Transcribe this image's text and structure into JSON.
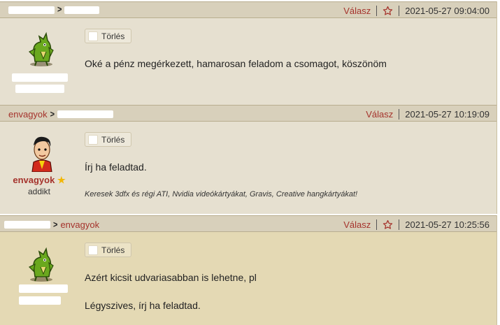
{
  "common": {
    "reply_label": "Válasz",
    "delete_label": "Törlés"
  },
  "posts": [
    {
      "author": "",
      "reply_to": "",
      "timestamp": "2021-05-27 09:04:00",
      "author_rank": "",
      "messages": [
        "Oké a pénz megérkezett, hamarosan feladom a csomagot, köszönöm"
      ],
      "signature": ""
    },
    {
      "author": "envagyok",
      "reply_to": "",
      "timestamp": "2021-05-27 10:19:09",
      "author_name": "envagyok",
      "author_rank": "addikt",
      "messages": [
        "Írj ha feladtad."
      ],
      "signature": "Keresek 3dfx és régi ATI, Nvidia videókártyákat, Gravis, Creative hangkártyákat!"
    },
    {
      "author": "",
      "reply_to": "envagyok",
      "timestamp": "2021-05-27 10:25:56",
      "author_rank": "",
      "messages": [
        "Azért kicsit udvariasabban is lehetne, pl",
        "Légyszives, írj ha feladtad."
      ],
      "signature": ""
    }
  ],
  "colors": {
    "header_bg": "#d8d0bb",
    "body_bg": "#e6e0d0",
    "body_bg_highlight": "#e4d9b4",
    "link": "#a5332c"
  },
  "icons": {
    "dragon_avatar": "green-dragon-avatar",
    "user_avatar": "cartoon-man-avatar",
    "star": "star-outline-icon",
    "rank_star": "gold-star-icon"
  }
}
